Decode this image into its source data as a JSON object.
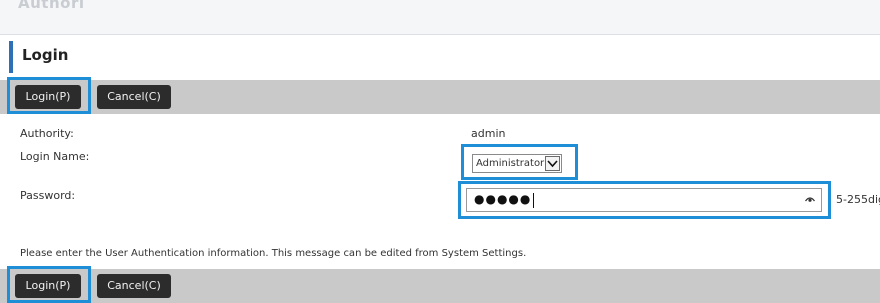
{
  "header": {
    "faded_title": "Authori",
    "title": "Login"
  },
  "toolbar_top": {
    "login_label": "Login(P)",
    "cancel_label": "Cancel(C)"
  },
  "form": {
    "authority_label": "Authority:",
    "authority_value": "admin",
    "login_name_label": "Login Name:",
    "login_name_selected": "Administrator",
    "password_label": "Password:",
    "password_masked": "●●●●●",
    "password_hint": "5-255dig"
  },
  "message": "Please enter the User Authentication information. This message can be edited from System Settings.",
  "toolbar_bottom": {
    "login_label": "Login(P)",
    "cancel_label": "Cancel(C)"
  },
  "colors": {
    "highlight": "#1e8fd6",
    "accent": "#2f6fb5",
    "button": "#2c2c2c",
    "toolbar": "#c9c9c9"
  },
  "icons": {
    "select_arrow": "chevron-down-icon",
    "password_reveal": "eye-icon"
  }
}
